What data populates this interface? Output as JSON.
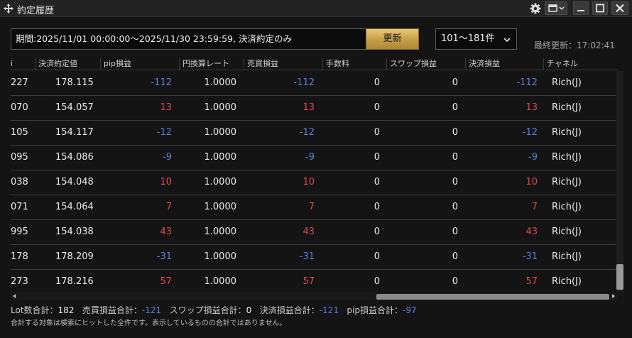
{
  "window": {
    "title": "約定履歴",
    "icons": {
      "move": "move-icon",
      "settings": "gear-icon",
      "layout": "panel-layout-icon",
      "minimize": "minimize-icon",
      "maximize": "maximize-icon",
      "close": "close-icon"
    }
  },
  "filter": {
    "period_text": "期間:2025/11/01 00:00:00～2025/11/30 23:59:59, 決済約定のみ",
    "update_label": "更新",
    "range_value": "101～181件",
    "last_updated_label": "最終更新：",
    "last_updated_time": "17:02:41"
  },
  "table": {
    "headers": [
      "i",
      "決済約定値",
      "pip損益",
      "円換算レート",
      "売買損益",
      "手数料",
      "スワップ損益",
      "決済損益",
      "チャネル"
    ],
    "rows": [
      {
        "id": "227",
        "price": "178.115",
        "pip": "-112",
        "rate": "1.0000",
        "trade_pl": "-112",
        "fee": "0",
        "swap": "0",
        "settle_pl": "-112",
        "channel": "Rich(J)"
      },
      {
        "id": "070",
        "price": "154.057",
        "pip": "13",
        "rate": "1.0000",
        "trade_pl": "13",
        "fee": "0",
        "swap": "0",
        "settle_pl": "13",
        "channel": "Rich(J)"
      },
      {
        "id": "105",
        "price": "154.117",
        "pip": "-12",
        "rate": "1.0000",
        "trade_pl": "-12",
        "fee": "0",
        "swap": "0",
        "settle_pl": "-12",
        "channel": "Rich(J)"
      },
      {
        "id": "095",
        "price": "154.086",
        "pip": "-9",
        "rate": "1.0000",
        "trade_pl": "-9",
        "fee": "0",
        "swap": "0",
        "settle_pl": "-9",
        "channel": "Rich(J)"
      },
      {
        "id": "038",
        "price": "154.048",
        "pip": "10",
        "rate": "1.0000",
        "trade_pl": "10",
        "fee": "0",
        "swap": "0",
        "settle_pl": "10",
        "channel": "Rich(J)"
      },
      {
        "id": "071",
        "price": "154.064",
        "pip": "7",
        "rate": "1.0000",
        "trade_pl": "7",
        "fee": "0",
        "swap": "0",
        "settle_pl": "7",
        "channel": "Rich(J)"
      },
      {
        "id": "995",
        "price": "154.038",
        "pip": "43",
        "rate": "1.0000",
        "trade_pl": "43",
        "fee": "0",
        "swap": "0",
        "settle_pl": "43",
        "channel": "Rich(J)"
      },
      {
        "id": "178",
        "price": "178.209",
        "pip": "-31",
        "rate": "1.0000",
        "trade_pl": "-31",
        "fee": "0",
        "swap": "0",
        "settle_pl": "-31",
        "channel": "Rich(J)"
      },
      {
        "id": "273",
        "price": "178.216",
        "pip": "57",
        "rate": "1.0000",
        "trade_pl": "57",
        "fee": "0",
        "swap": "0",
        "settle_pl": "57",
        "channel": "Rich(J)"
      }
    ]
  },
  "totals": {
    "lot_label": "Lot数合計：",
    "lot_value": "182",
    "trade_label": "売買損益合計：",
    "trade_value": "-121",
    "swap_label": "スワップ損益合計：",
    "swap_value": "0",
    "settle_label": "決済損益合計：",
    "settle_value": "-121",
    "pip_label": "pip損益合計：",
    "pip_value": "-97",
    "note": "合計する対象は検索にヒットした全件です。表示しているものの合計ではありません。"
  },
  "colors": {
    "negative": "#5a7ee0",
    "positive": "#e04848",
    "accent_button": "#c9a048"
  }
}
